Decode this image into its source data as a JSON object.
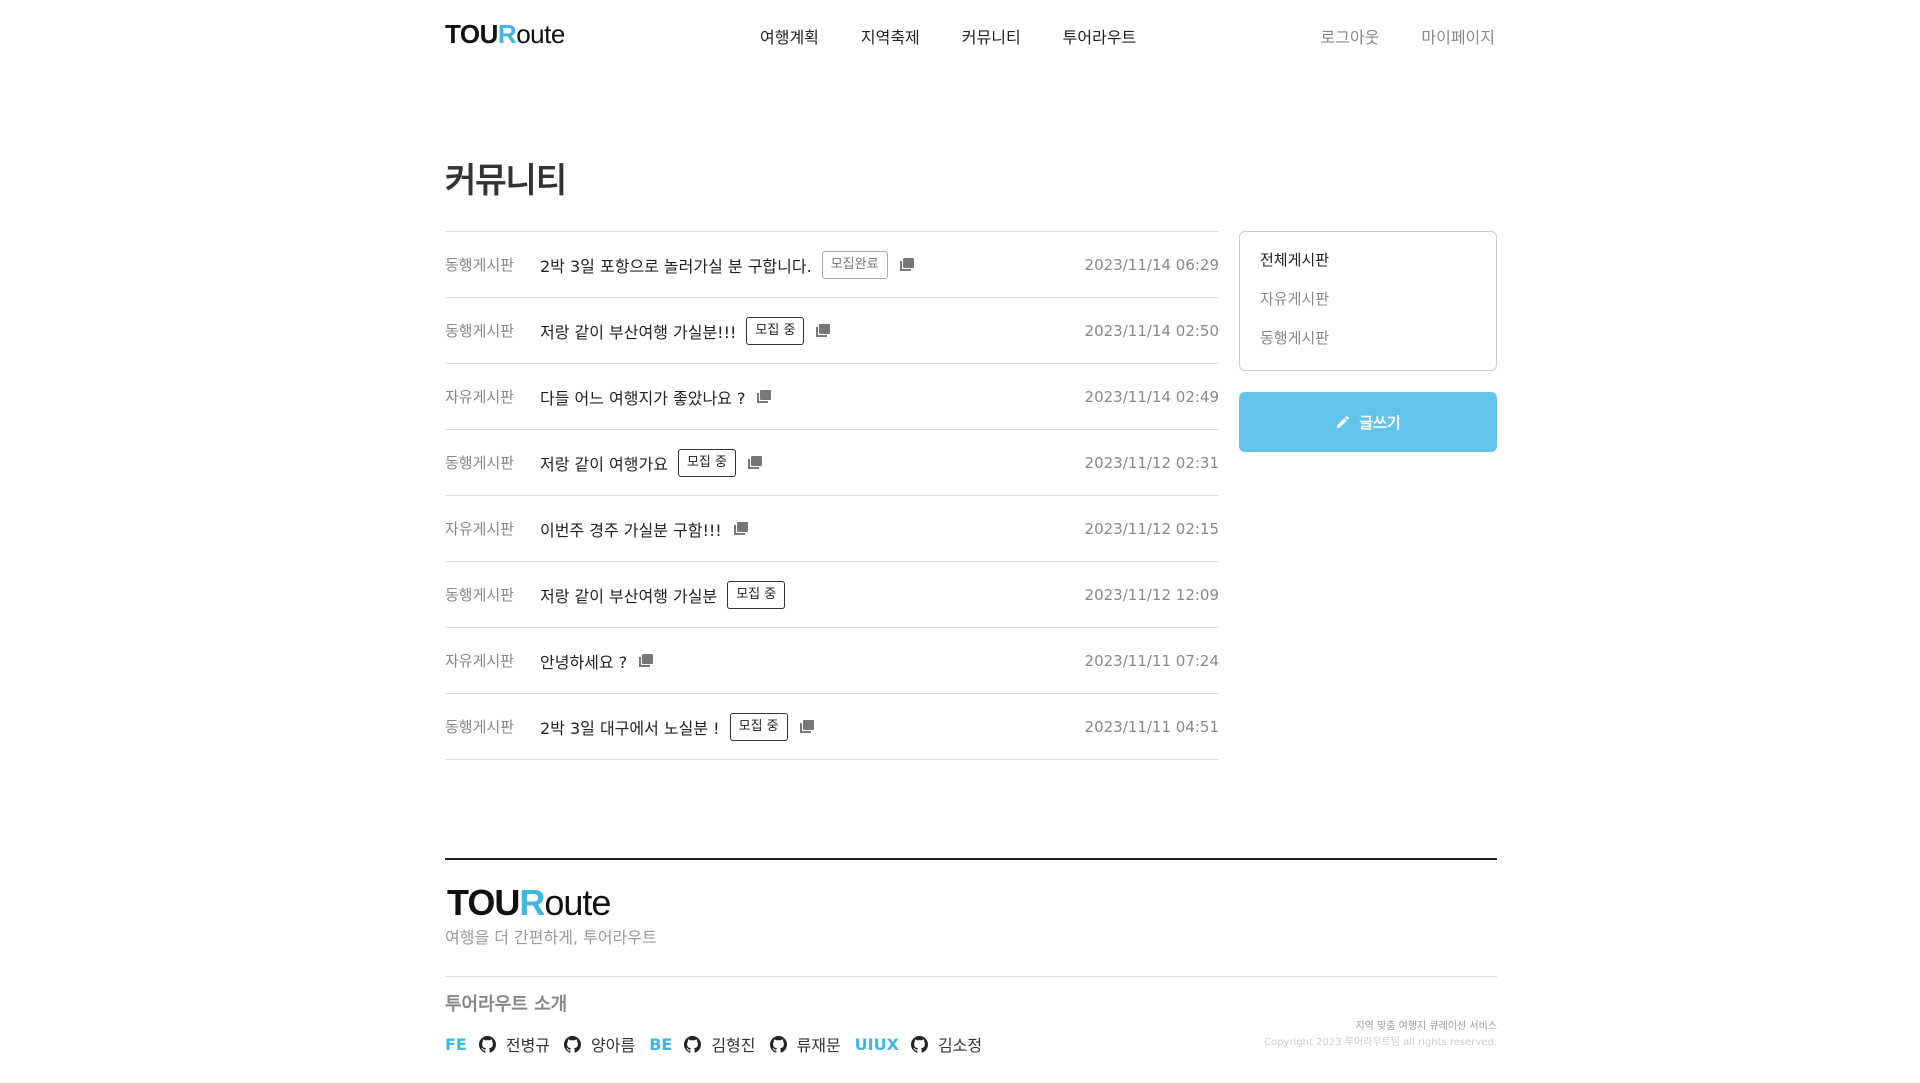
{
  "brand": {
    "logo_tou": "TOU",
    "logo_r": "R",
    "logo_oute": "oute"
  },
  "nav": {
    "items": [
      "여행계획",
      "지역축제",
      "커뮤니티",
      "투어라우트"
    ]
  },
  "user_nav": {
    "logout": "로그아웃",
    "mypage": "마이페이지"
  },
  "page": {
    "title": "커뮤니티"
  },
  "posts": [
    {
      "category": "동행게시판",
      "title": "2박 3일 포항으로 놀러가실 분 구합니다.",
      "badge": "모집완료",
      "badge_state": "done",
      "has_image": true,
      "date": "2023/11/14 06:29"
    },
    {
      "category": "동행게시판",
      "title": "저랑 같이 부산여행 가실분!!!",
      "badge": "모집 중",
      "badge_state": "open",
      "has_image": true,
      "date": "2023/11/14 02:50"
    },
    {
      "category": "자유게시판",
      "title": "다들 어느 여행지가 좋았나요 ?",
      "badge": "",
      "badge_state": "",
      "has_image": true,
      "date": "2023/11/14 02:49"
    },
    {
      "category": "동행게시판",
      "title": "저랑 같이 여행가요",
      "badge": "모집 중",
      "badge_state": "open",
      "has_image": true,
      "date": "2023/11/12 02:31"
    },
    {
      "category": "자유게시판",
      "title": "이번주 경주 가실분 구함!!!",
      "badge": "",
      "badge_state": "",
      "has_image": true,
      "date": "2023/11/12 02:15"
    },
    {
      "category": "동행게시판",
      "title": "저랑 같이 부산여행 가실분",
      "badge": "모집 중",
      "badge_state": "open",
      "has_image": false,
      "date": "2023/11/12 12:09"
    },
    {
      "category": "자유게시판",
      "title": "안녕하세요 ?",
      "badge": "",
      "badge_state": "",
      "has_image": true,
      "date": "2023/11/11 07:24"
    },
    {
      "category": "동행게시판",
      "title": "2박 3일 대구에서 노실분 !",
      "badge": "모집 중",
      "badge_state": "open",
      "has_image": true,
      "date": "2023/11/11 04:51"
    }
  ],
  "sidebar": {
    "items": [
      "전체게시판",
      "자유게시판",
      "동행게시판"
    ],
    "active": "전체게시판"
  },
  "write_button": {
    "label": "글쓰기",
    "icon": "pencil-icon"
  },
  "footer": {
    "slogan": "여행을 더 간편하게, 투어라우트",
    "about": "투어라우트 소개",
    "team": [
      {
        "role": "FE",
        "members": [
          "전병규",
          "양아름"
        ]
      },
      {
        "role": "BE",
        "members": [
          "김형진",
          "류재문"
        ]
      },
      {
        "role": "UIUX",
        "members": [
          "김소정"
        ]
      }
    ],
    "service": "지역 맞춤 여행지 큐레이션 서비스",
    "copyright": "Copyright 2023 투어라우트팀 all rights reserved."
  },
  "colors": {
    "accent": "#3fb6e6",
    "button": "#62c3ec"
  }
}
